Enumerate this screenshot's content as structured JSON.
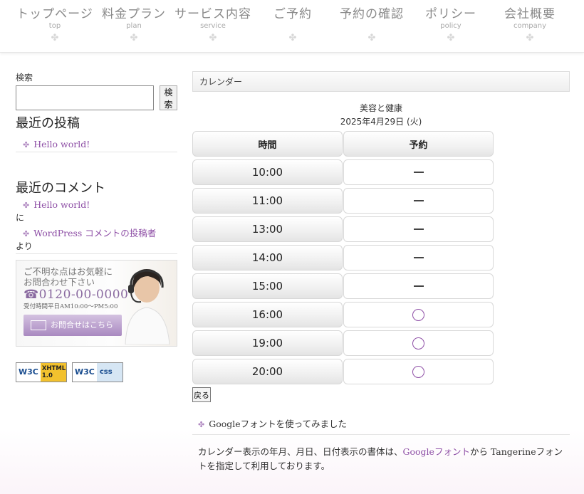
{
  "nav": [
    {
      "label": "トップページ",
      "sub": "top"
    },
    {
      "label": "料金プラン",
      "sub": "plan"
    },
    {
      "label": "サービス内容",
      "sub": "service"
    },
    {
      "label": "ご予約",
      "sub": ""
    },
    {
      "label": "予約の確認",
      "sub": ""
    },
    {
      "label": "ポリシー",
      "sub": "policy"
    },
    {
      "label": "会社概要",
      "sub": "company"
    }
  ],
  "sidebar": {
    "search_label": "検索",
    "search_value": "",
    "search_button": "検索",
    "recent_posts_title": "最近の投稿",
    "recent_posts": [
      "Hello world!"
    ],
    "recent_comments_title": "最近のコメント",
    "comments": [
      {
        "post": "Hello world!",
        "joiner": "に"
      },
      {
        "post": "WordPress コメントの投稿者",
        "joiner": "より"
      }
    ],
    "banner": {
      "line1": "ご不明な点はお気軽に",
      "line2": "お問合わせ下さい",
      "phone": "☎0120-00-0000",
      "hours": "受付時間平日AM10:00〜PM5:00",
      "button": "お問合せはこちら"
    },
    "badges": [
      {
        "prefix": "W3C",
        "label": "XHTML 1.0",
        "color": "#f2c12e"
      },
      {
        "prefix": "W3C",
        "label": "css",
        "color": "#5d9ed6"
      }
    ]
  },
  "calendar": {
    "header": "カレンダー",
    "shop": "美容と健康",
    "date": "2025年4月29日 (火)",
    "col_time": "時間",
    "col_reservation": "予約",
    "slots": [
      {
        "time": "10:00",
        "status": "unavailable"
      },
      {
        "time": "11:00",
        "status": "unavailable"
      },
      {
        "time": "13:00",
        "status": "unavailable"
      },
      {
        "time": "14:00",
        "status": "unavailable"
      },
      {
        "time": "15:00",
        "status": "unavailable"
      },
      {
        "time": "16:00",
        "status": "available"
      },
      {
        "time": "19:00",
        "status": "available"
      },
      {
        "time": "20:00",
        "status": "available"
      }
    ],
    "back_button": "戻る"
  },
  "post": {
    "title": "Googleフォントを使ってみました",
    "body_before": "カレンダー表示の年月、月日、日付表示の書体は、",
    "body_link": "Googleフォント",
    "body_after": "から Tangerineフォントを指定して利用しております。"
  },
  "colors": {
    "accent": "#8e4fa6",
    "nav_text": "#8a8a8a"
  }
}
